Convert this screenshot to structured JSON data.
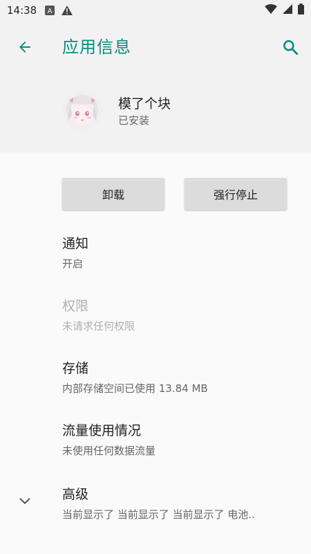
{
  "status_bar": {
    "time": "14:38",
    "icons": [
      "a-notification-icon",
      "warning-icon",
      "wifi-icon",
      "signal-icon",
      "battery-icon"
    ]
  },
  "header": {
    "title": "应用信息",
    "back_icon": "arrow-left-icon",
    "search_icon": "search-icon"
  },
  "app": {
    "name": "模了个块",
    "status": "已安装"
  },
  "buttons": {
    "uninstall": "卸载",
    "force_stop": "强行停止"
  },
  "items": [
    {
      "title": "通知",
      "summary": "开启",
      "enabled": true
    },
    {
      "title": "权限",
      "summary": "未请求任何权限",
      "enabled": false
    },
    {
      "title": "存储",
      "summary": "内部存储空间已使用 13.84 MB",
      "enabled": true
    },
    {
      "title": "流量使用情况",
      "summary": "未使用任何数据流量",
      "enabled": true
    },
    {
      "title": "高级",
      "summary": "当前显示了 当前显示了 当前显示了 电池..",
      "enabled": true
    }
  ],
  "colors": {
    "accent": "#0f8a80",
    "header_bg": "#f2f2f2",
    "body_bg": "#fafafa",
    "button_bg": "#dcdcdc"
  }
}
